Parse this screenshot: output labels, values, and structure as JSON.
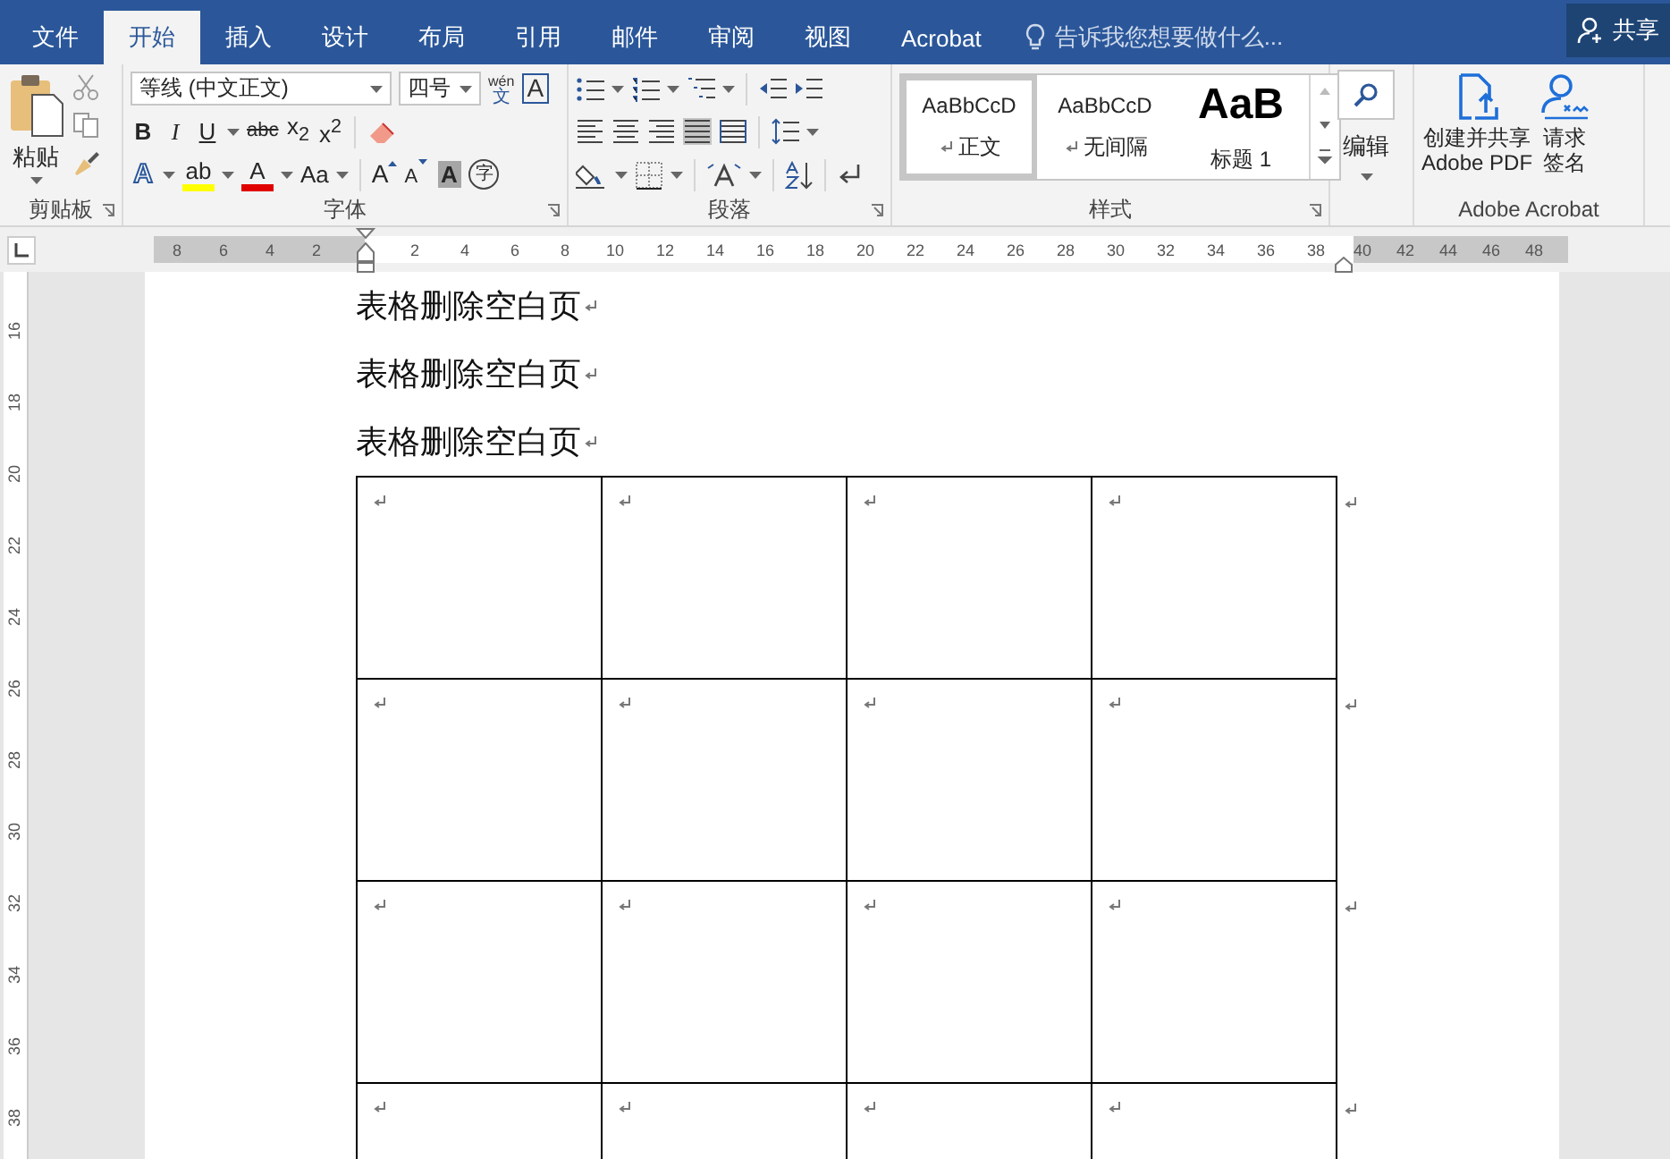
{
  "tabs": [
    {
      "label": "文件",
      "selected": false
    },
    {
      "label": "开始",
      "selected": true
    },
    {
      "label": "插入",
      "selected": false
    },
    {
      "label": "设计",
      "selected": false
    },
    {
      "label": "布局",
      "selected": false
    },
    {
      "label": "引用",
      "selected": false
    },
    {
      "label": "邮件",
      "selected": false
    },
    {
      "label": "审阅",
      "selected": false
    },
    {
      "label": "视图",
      "selected": false
    },
    {
      "label": "Acrobat",
      "selected": false
    }
  ],
  "tell_me": {
    "placeholder": "告诉我您想要做什么..."
  },
  "share_button": {
    "label": "共享"
  },
  "clipboard": {
    "paste_label": "粘贴",
    "group_label": "剪贴板"
  },
  "font": {
    "font_name": "等线 (中文正文)",
    "font_size": "四号",
    "phonetic_top": "wén",
    "phonetic_bottom": "文",
    "border_glyph": "A",
    "format_buttons": [
      {
        "glyph": "B",
        "kind": "bold",
        "dropdown": false
      },
      {
        "glyph": "I",
        "kind": "italic",
        "dropdown": false
      },
      {
        "glyph": "U",
        "kind": "underline",
        "dropdown": true
      },
      {
        "glyph": "abc",
        "kind": "strike",
        "dropdown": false
      },
      {
        "glyph": "x$_{2}$",
        "kind": "plain",
        "dropdown": false
      },
      {
        "glyph": "x$^{2}$",
        "kind": "plain",
        "dropdown": false
      }
    ],
    "effect_buttons": [
      {
        "glyph": "A",
        "kind": "effects",
        "dropdown": true
      },
      {
        "glyph": "ab",
        "kind": "colorbar",
        "color": "#ffff00",
        "dropdown": true
      },
      {
        "glyph": "A",
        "kind": "colorbar",
        "color": "#e00000",
        "dropdown": true
      },
      {
        "glyph": "Aa",
        "kind": "plain",
        "dropdown": true
      }
    ],
    "size_buttons": [
      {
        "glyph": "A",
        "kind": "grow"
      },
      {
        "glyph": "A",
        "kind": "shrink"
      },
      {
        "glyph": "A",
        "kind": "shaded"
      },
      {
        "glyph": "字",
        "kind": "enclosed"
      }
    ],
    "group_label": "字体"
  },
  "paragraph": {
    "alignment": [
      {
        "kind": "left",
        "selected": false
      },
      {
        "kind": "center",
        "selected": false
      },
      {
        "kind": "right",
        "selected": false
      },
      {
        "kind": "justify",
        "selected": true
      },
      {
        "kind": "distributed",
        "selected": false
      }
    ],
    "group_label": "段落"
  },
  "styles": {
    "items": [
      {
        "preview": "AaBbCcD",
        "label": "正文",
        "kind": "normal",
        "paragraph_mark": true,
        "selected": true
      },
      {
        "preview": "AaBbCcD",
        "label": "无间隔",
        "kind": "normal",
        "paragraph_mark": true,
        "selected": false
      },
      {
        "preview": "AaB",
        "label": "标题 1",
        "kind": "heading",
        "paragraph_mark": false,
        "selected": false
      }
    ],
    "group_label": "样式"
  },
  "editing": {
    "label": "编辑"
  },
  "acrobat": {
    "buttons": [
      {
        "kind": "share",
        "lines": [
          "创建并共享",
          "Adobe PDF"
        ]
      },
      {
        "kind": "sign",
        "lines": [
          "请求",
          "签名"
        ]
      }
    ],
    "group_label": "Adobe Acrobat"
  },
  "ruler": {
    "left_ticks": [
      "8",
      "6",
      "4",
      "2"
    ],
    "ticks": [
      "2",
      "4",
      "6",
      "8",
      "10",
      "12",
      "14",
      "16",
      "18",
      "20",
      "22",
      "24",
      "26",
      "28",
      "30",
      "32",
      "34",
      "36",
      "38"
    ],
    "right_ticks": [
      "40",
      "42",
      "44",
      "46",
      "48"
    ]
  },
  "vertical_ruler": {
    "ticks": [
      "16",
      "18",
      "20",
      "22",
      "24",
      "26",
      "28",
      "30",
      "32",
      "34",
      "36",
      "38"
    ]
  },
  "document": {
    "paragraphs": [
      {
        "text": "表格删除空白页",
        "paragraph_mark": true
      },
      {
        "text": "表格删除空白页",
        "paragraph_mark": true
      },
      {
        "text": "表格删除空白页",
        "paragraph_mark": true
      }
    ],
    "table": {
      "rows": [
        {
          "end_mark": true,
          "cells": [
            {
              "paragraph_mark": true
            },
            {
              "paragraph_mark": true
            },
            {
              "paragraph_mark": true
            },
            {
              "paragraph_mark": true
            }
          ]
        },
        {
          "end_mark": true,
          "cells": [
            {
              "paragraph_mark": true
            },
            {
              "paragraph_mark": true
            },
            {
              "paragraph_mark": true
            },
            {
              "paragraph_mark": true
            }
          ]
        },
        {
          "end_mark": true,
          "cells": [
            {
              "paragraph_mark": true
            },
            {
              "paragraph_mark": true
            },
            {
              "paragraph_mark": true
            },
            {
              "paragraph_mark": true
            }
          ]
        },
        {
          "end_mark": true,
          "cells": [
            {
              "paragraph_mark": true
            },
            {
              "paragraph_mark": true
            },
            {
              "paragraph_mark": true
            },
            {
              "paragraph_mark": true
            }
          ]
        }
      ]
    }
  }
}
